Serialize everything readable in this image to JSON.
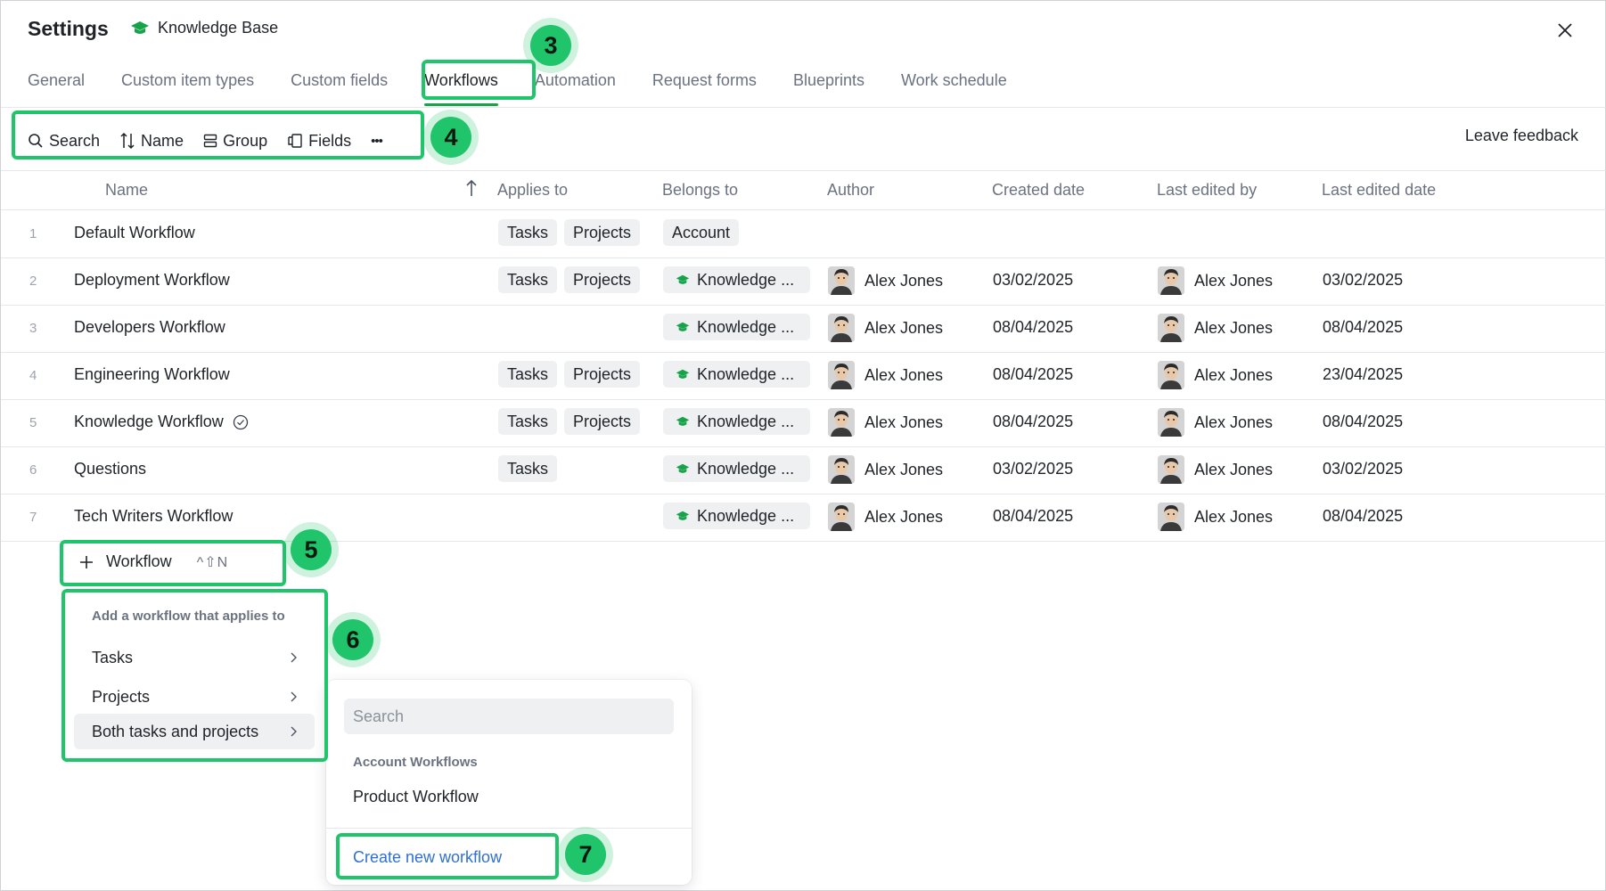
{
  "header": {
    "title": "Settings",
    "space_name": "Knowledge Base",
    "brand_color": "#16a34a"
  },
  "tabs": [
    {
      "label": "General"
    },
    {
      "label": "Custom item types"
    },
    {
      "label": "Custom fields"
    },
    {
      "label": "Workflows",
      "active": true
    },
    {
      "label": "Automation"
    },
    {
      "label": "Request forms"
    },
    {
      "label": "Blueprints"
    },
    {
      "label": "Work schedule"
    }
  ],
  "toolbar": {
    "search": "Search",
    "name": "Name",
    "group": "Group",
    "fields": "Fields",
    "more": "•••",
    "feedback": "Leave feedback"
  },
  "table": {
    "columns": {
      "name": "Name",
      "applies_to": "Applies to",
      "belongs_to": "Belongs to",
      "author": "Author",
      "created": "Created date",
      "edited_by": "Last edited by",
      "edited_date": "Last edited date"
    },
    "rows": [
      {
        "num": "1",
        "name": "Default Workflow",
        "tasks": "Tasks",
        "projects": "Projects",
        "belongs": "Account",
        "author": "",
        "created": "",
        "edited_by": "",
        "edited_date": ""
      },
      {
        "num": "2",
        "name": "Deployment Workflow",
        "tasks": "Tasks",
        "projects": "Projects",
        "belongs": "Knowledge ...",
        "author": "Alex Jones",
        "created": "03/02/2025",
        "edited_by": "Alex Jones",
        "edited_date": "03/02/2025"
      },
      {
        "num": "3",
        "name": "Developers Workflow",
        "tasks": "",
        "projects": "",
        "belongs": "Knowledge ...",
        "author": "Alex Jones",
        "created": "08/04/2025",
        "edited_by": "Alex Jones",
        "edited_date": "08/04/2025"
      },
      {
        "num": "4",
        "name": "Engineering Workflow",
        "tasks": "Tasks",
        "projects": "Projects",
        "belongs": "Knowledge ...",
        "author": "Alex Jones",
        "created": "08/04/2025",
        "edited_by": "Alex Jones",
        "edited_date": "23/04/2025"
      },
      {
        "num": "5",
        "name": "Knowledge Workflow",
        "tasks": "Tasks",
        "projects": "Projects",
        "belongs": "Knowledge ...",
        "author": "Alex Jones",
        "created": "08/04/2025",
        "edited_by": "Alex Jones",
        "edited_date": "08/04/2025",
        "default_check": true
      },
      {
        "num": "6",
        "name": "Questions",
        "tasks": "Tasks",
        "projects": "",
        "belongs": "Knowledge ...",
        "author": "Alex Jones",
        "created": "03/02/2025",
        "edited_by": "Alex Jones",
        "edited_date": "03/02/2025"
      },
      {
        "num": "7",
        "name": "Tech Writers Workflow",
        "tasks": "",
        "projects": "",
        "belongs": "Knowledge ...",
        "author": "Alex Jones",
        "created": "08/04/2025",
        "edited_by": "Alex Jones",
        "edited_date": "08/04/2025"
      }
    ]
  },
  "add_workflow": {
    "label": "Workflow",
    "shortcut": "^⇧N"
  },
  "applies_menu": {
    "title": "Add a workflow that applies to",
    "items": [
      {
        "label": "Tasks"
      },
      {
        "label": "Projects"
      },
      {
        "label": "Both tasks and projects",
        "hovered": true
      }
    ]
  },
  "workflow_menu": {
    "search_placeholder": "Search",
    "group_title": "Account Workflows",
    "item": "Product Workflow",
    "create": "Create new workflow"
  },
  "annotations": {
    "highlight_color": "#1fc46b",
    "badges": [
      "3",
      "4",
      "5",
      "6",
      "7"
    ]
  }
}
